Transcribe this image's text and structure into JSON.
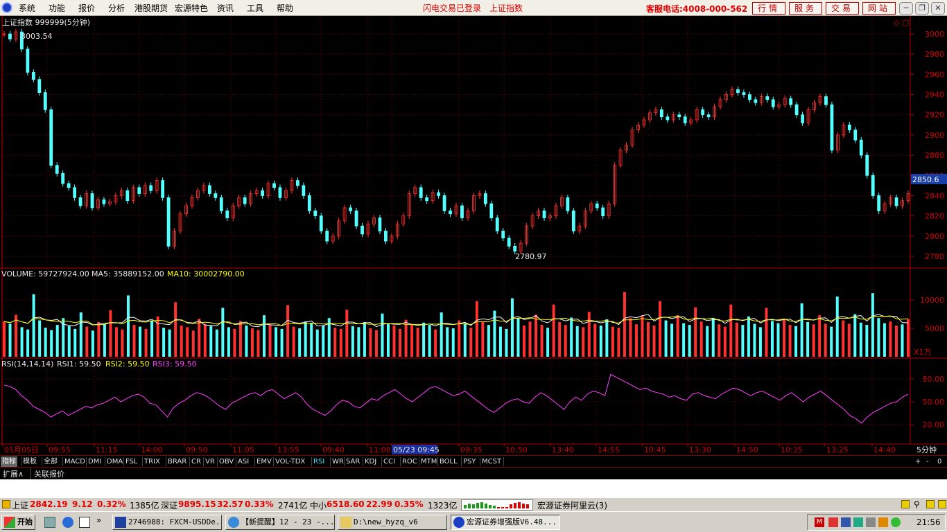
{
  "menu": {
    "items": [
      "系统",
      "功能",
      "报价",
      "分析",
      "港股期货",
      "宏源特色",
      "资讯",
      "工具",
      "帮助"
    ],
    "flash_status": "闪电交易已登录",
    "index_link": "上证指数",
    "hotline": "客服电话:4008-000-562",
    "quick_buttons": [
      "行情",
      "服务",
      "交易",
      "网站"
    ],
    "window_buttons": [
      "minimize",
      "restore",
      "close"
    ]
  },
  "chart": {
    "title": "上证指数 999999(5分钟)",
    "high_label": "3003.54",
    "low_label": "2780.97",
    "current_price_tag": "2850.6",
    "price_axis": [
      "3000",
      "2980",
      "2960",
      "2940",
      "2920",
      "2900",
      "2880",
      "2860",
      "2840",
      "2820",
      "2800",
      "2780"
    ],
    "volume": {
      "label": "VOLUME: 59727924.00",
      "ma5": "MA5: 35889152.00",
      "ma10": "MA10: 30002790.00",
      "axis": [
        "10000",
        "5000"
      ],
      "unit": "X1万"
    },
    "rsi": {
      "label": "RSI(14,14,14)",
      "rsi1": "RSI1: 59.50",
      "rsi2": "RSI2: 59.50",
      "rsi3": "RSI3: 59.50",
      "axis": [
        "80.00",
        "50.00",
        "20.00"
      ]
    },
    "time_axis": [
      "05月05日",
      "09:55",
      "11:15",
      "14:00",
      "09:50",
      "11:05",
      "13:55",
      "09:40",
      "11:00",
      "05/23 09:45",
      "09:35",
      "10:50",
      "13:40",
      "14:55",
      "10:45",
      "13:30",
      "14:50",
      "10:35",
      "13:25",
      "14:40"
    ],
    "period_label": "5分钟",
    "colors": {
      "up": "#ff3232",
      "down": "#54ffff",
      "ma5": "#ffffff",
      "ma10": "#ffff00",
      "rsi": "#ff40ff",
      "grid": "#800000"
    }
  },
  "chart_data": {
    "type": "line",
    "title": "上证指数 999999(5分钟)",
    "ylim": [
      2770,
      3010
    ],
    "y": [
      3000,
      2995,
      3002,
      2985,
      2962,
      2955,
      2942,
      2925,
      2870,
      2862,
      2852,
      2848,
      2838,
      2830,
      2842,
      2828,
      2836,
      2832,
      2834,
      2840,
      2845,
      2835,
      2848,
      2842,
      2850,
      2845,
      2855,
      2838,
      2790,
      2805,
      2822,
      2830,
      2838,
      2845,
      2850,
      2842,
      2838,
      2825,
      2818,
      2830,
      2838,
      2832,
      2842,
      2845,
      2840,
      2852,
      2848,
      2838,
      2845,
      2855,
      2850,
      2840,
      2825,
      2820,
      2805,
      2795,
      2800,
      2815,
      2828,
      2825,
      2810,
      2802,
      2812,
      2818,
      2805,
      2795,
      2800,
      2812,
      2820,
      2842,
      2848,
      2838,
      2835,
      2843,
      2840,
      2825,
      2822,
      2830,
      2818,
      2825,
      2840,
      2842,
      2832,
      2818,
      2805,
      2798,
      2790,
      2785,
      2793,
      2810,
      2820,
      2825,
      2818,
      2820,
      2830,
      2838,
      2825,
      2805,
      2810,
      2825,
      2832,
      2828,
      2820,
      2832,
      2870,
      2885,
      2890,
      2905,
      2910,
      2915,
      2922,
      2925,
      2918,
      2915,
      2920,
      2918,
      2912,
      2915,
      2925,
      2920,
      2918,
      2928,
      2935,
      2940,
      2945,
      2942,
      2940,
      2935,
      2932,
      2938,
      2935,
      2928,
      2930,
      2936,
      2930,
      2920,
      2912,
      2925,
      2932,
      2938,
      2930,
      2885,
      2900,
      2910,
      2905,
      2895,
      2880,
      2860,
      2840,
      2825,
      2832,
      2838,
      2830,
      2835,
      2842
    ],
    "series": [
      {
        "name": "VOLUME",
        "values": [
          6200,
          5800,
          7400,
          5200,
          4800,
          11000,
          6400,
          5100,
          4700,
          5600,
          6800,
          5400,
          4900,
          7800,
          5300,
          4600,
          6100,
          5700,
          8200,
          5200,
          4800,
          10800,
          5600,
          5300,
          4900,
          6400,
          7100,
          5100,
          4800,
          9600,
          5500,
          5200,
          4600,
          6700,
          5800,
          5400,
          4800,
          8600,
          5200,
          4900,
          6300,
          5500,
          5000,
          4700,
          7300,
          5600,
          5200,
          4900,
          9100,
          5300,
          5000,
          6200,
          5900,
          4800,
          5500,
          6800,
          5100,
          4900,
          8300,
          5400,
          5200,
          6100,
          5000,
          4700,
          7600,
          5800,
          5500,
          4900,
          6500,
          5700,
          5100,
          6000,
          5600,
          4800,
          7800,
          5200,
          5000,
          6400,
          5900,
          5100,
          9800,
          6200,
          5600,
          8100,
          5300,
          4900,
          10300,
          6800,
          5500,
          6200,
          7400,
          5600,
          5100,
          9200,
          6100,
          5600,
          6900,
          5400,
          5200,
          7900,
          5800,
          5500,
          6600,
          5300,
          5100,
          11400,
          6800,
          5700,
          7200,
          6100,
          5500,
          9800,
          6400,
          5800,
          7300,
          5900,
          5600,
          8700,
          6200,
          5400,
          6800,
          5700,
          5300,
          9200,
          6000,
          5600,
          7100,
          5800,
          5200,
          8600,
          6300,
          5900,
          6700,
          5600,
          5400,
          9400,
          6100,
          5700,
          7300,
          5800,
          5300,
          10600,
          6400,
          5800,
          7500,
          6000,
          5600,
          11200,
          6800,
          5900,
          6200,
          5500,
          5700,
          6600
        ]
      },
      {
        "name": "RSI1",
        "values": [
          72,
          70,
          66,
          58,
          52,
          44,
          40,
          36,
          30,
          34,
          38,
          32,
          36,
          40,
          44,
          42,
          46,
          48,
          52,
          56,
          50,
          54,
          58,
          60,
          56,
          48,
          46,
          38,
          30,
          42,
          48,
          52,
          58,
          62,
          60,
          56,
          50,
          44,
          40,
          48,
          52,
          56,
          60,
          62,
          58,
          64,
          66,
          60,
          54,
          58,
          62,
          56,
          46,
          40,
          36,
          32,
          38,
          46,
          52,
          50,
          44,
          42,
          48,
          54,
          52,
          58,
          62,
          66,
          60,
          54,
          50,
          56,
          62,
          68,
          70,
          66,
          62,
          58,
          60,
          64,
          58,
          52,
          46,
          40,
          36,
          42,
          48,
          52,
          54,
          50,
          48,
          56,
          62,
          58,
          52,
          46,
          40,
          50,
          56,
          52,
          60,
          64,
          62,
          58,
          86,
          82,
          78,
          74,
          70,
          66,
          68,
          64,
          62,
          60,
          56,
          58,
          54,
          52,
          60,
          62,
          58,
          56,
          54,
          60,
          64,
          68,
          66,
          62,
          58,
          62,
          64,
          60,
          56,
          52,
          58,
          62,
          56,
          50,
          56,
          60,
          64,
          58,
          52,
          46,
          40,
          32,
          28,
          22,
          30,
          36,
          40,
          44,
          48,
          50,
          56,
          60
        ]
      }
    ],
    "ylabel": ""
  },
  "indicator_tabs": [
    "指标",
    "模板",
    "全部",
    "MACD",
    "DMI",
    "DMA",
    "FSL",
    "TRIX",
    "BRAR",
    "CR",
    "VR",
    "OBV",
    "ASI",
    "EMV",
    "VOL-TDX",
    "RSI",
    "WR",
    "SAR",
    "KDJ",
    "CCI",
    "ROC",
    "MTM",
    "BOLL",
    "PSY",
    "MCST"
  ],
  "selected_indicator": "RSI",
  "tab_controls": [
    "+",
    "-",
    "0"
  ],
  "ext_tabs": [
    "扩展∧",
    "关联报价"
  ],
  "status": {
    "sh_label": "上证",
    "sh_price": "2842.19",
    "sh_change": "9.12",
    "sh_pct": "0.32%",
    "sh_amount": "1385亿",
    "sz_label": "深证",
    "sz_price": "9895.15",
    "sz_change": "32.57",
    "sz_pct": "0.33%",
    "sz_amount": "2741亿",
    "zx_label": "中小",
    "zx_price": "6518.60",
    "zx_change": "22.99",
    "zx_pct": "0.35%",
    "zx_amount": "1323亿",
    "server": "宏源证券阿里云(3)"
  },
  "taskbar": {
    "start": "开始",
    "items": [
      "2746988: FXCM-USDDe...",
      "【新提醒】12 - 23 -...",
      "D:\\new_hyzq_v6",
      "宏源证券增强版V6.48..."
    ],
    "clock": "21:56"
  }
}
